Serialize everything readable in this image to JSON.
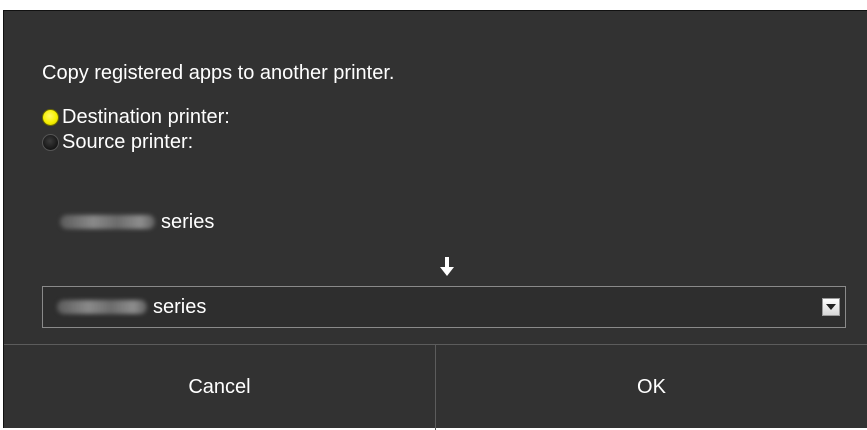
{
  "dialog": {
    "heading": "Copy registered apps to another printer.",
    "radio_options": [
      {
        "label": "Destination printer:",
        "selected": true
      },
      {
        "label": "Source printer:",
        "selected": false
      }
    ],
    "source_printer": {
      "suffix": "series"
    },
    "destination_select": {
      "selected_suffix": "series"
    },
    "buttons": {
      "cancel": "Cancel",
      "ok": "OK"
    }
  },
  "colors": {
    "background": "#323232",
    "radio_selected": "#f7f000",
    "text": "#ffffff"
  },
  "icons": {
    "arrow": "down-arrow-icon",
    "dropdown": "dropdown-arrow-icon"
  }
}
